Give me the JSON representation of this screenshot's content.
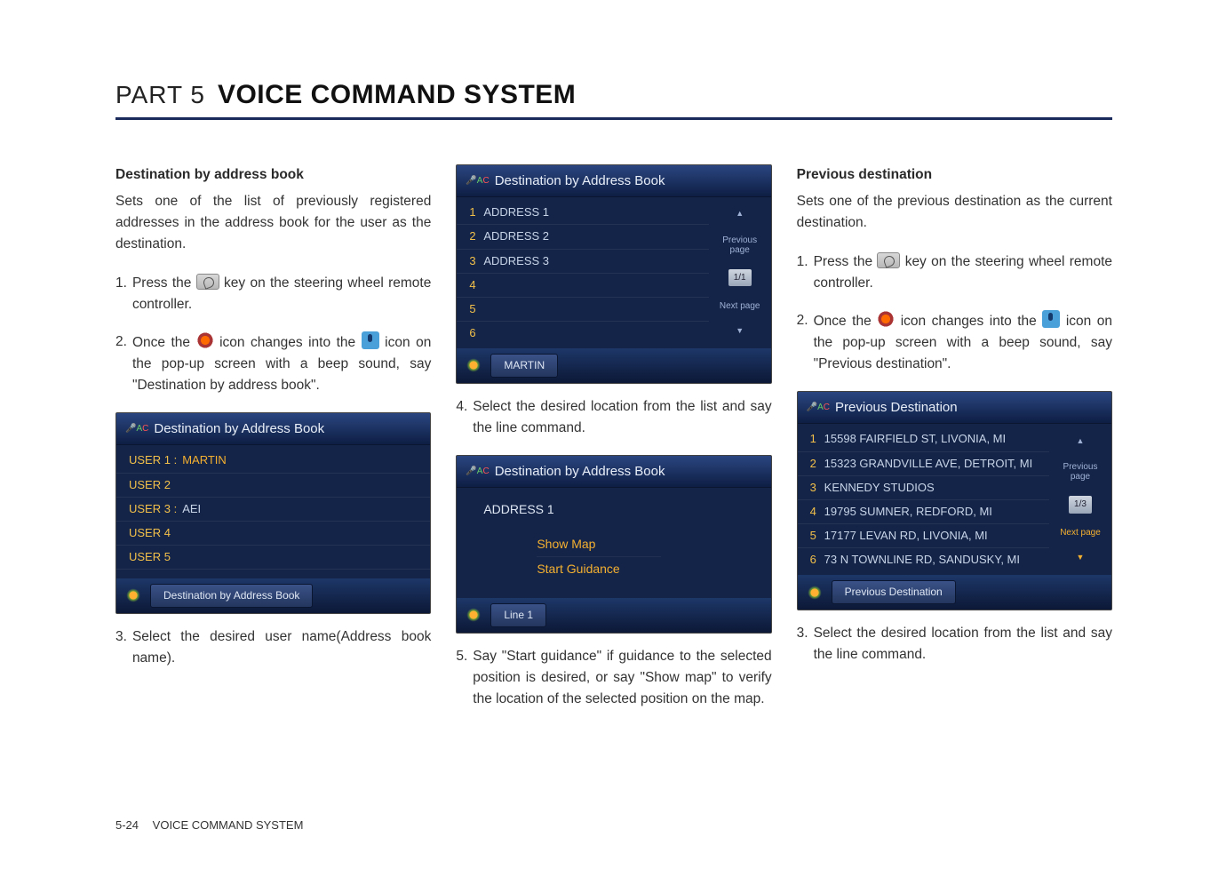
{
  "header": {
    "part_label": "PART 5",
    "title": "VOICE COMMAND SYSTEM"
  },
  "col1": {
    "subhead": "Destination by address book",
    "intro": "Sets one of the list of previously registered addresses in the address book for the user as the destination.",
    "step1_num": "1.",
    "step1a": "Press the ",
    "step1b": " key on the steering wheel remote controller.",
    "step2_num": "2.",
    "step2a": "Once the ",
    "step2b": " icon changes into the ",
    "step2c": " icon on the pop-up screen with a beep sound, say \"Destination by address book\".",
    "shot_title": "Destination by Address Book",
    "users": [
      {
        "label": "USER 1 :",
        "name": "MARTIN",
        "highlight": true
      },
      {
        "label": "USER 2",
        "name": "",
        "highlight": false
      },
      {
        "label": "USER 3 :",
        "name": "AEI",
        "highlight": false
      },
      {
        "label": "USER 4",
        "name": "",
        "highlight": false
      },
      {
        "label": "USER 5",
        "name": "",
        "highlight": false
      }
    ],
    "foot": "Destination by Address Book",
    "step3_num": "3.",
    "step3": "Select the desired user name(Address book name)."
  },
  "col2": {
    "shot1_title": "Destination by Address Book",
    "addr_rows": [
      {
        "idx": "1",
        "val": "ADDRESS 1"
      },
      {
        "idx": "2",
        "val": "ADDRESS 2"
      },
      {
        "idx": "3",
        "val": "ADDRESS 3"
      },
      {
        "idx": "4",
        "val": ""
      },
      {
        "idx": "5",
        "val": ""
      },
      {
        "idx": "6",
        "val": ""
      }
    ],
    "side_prev": "Previous page",
    "side_pager": "1/1",
    "side_next": "Next page",
    "foot1": "MARTIN",
    "step4_num": "4.",
    "step4": "Select the desired location from the list and say the line command.",
    "shot2_title": "Destination by Address Book",
    "addr_header": "ADDRESS 1",
    "opt1": "Show Map",
    "opt2": "Start Guidance",
    "foot2": "Line 1",
    "step5_num": "5.",
    "step5": "Say \"Start guidance\" if guidance to the selected position is desired, or say \"Show map\" to verify the location of the selected position on the map."
  },
  "col3": {
    "subhead": "Previous destination",
    "intro": "Sets one of the previous destination as the current destination.",
    "step1_num": "1.",
    "step1a": "Press the ",
    "step1b": " key on the steering wheel remote controller.",
    "step2_num": "2.",
    "step2a": "Once the ",
    "step2b": " icon changes into the ",
    "step2c": " icon on the pop-up screen with a beep sound, say \"Previous destination\".",
    "shot_title": "Previous Destination",
    "rows": [
      {
        "idx": "1",
        "val": "15598 FAIRFIELD ST, LIVONIA, MI"
      },
      {
        "idx": "2",
        "val": "15323 GRANDVILLE AVE, DETROIT, MI"
      },
      {
        "idx": "3",
        "val": "KENNEDY STUDIOS"
      },
      {
        "idx": "4",
        "val": "19795 SUMNER, REDFORD, MI"
      },
      {
        "idx": "5",
        "val": "17177 LEVAN RD, LIVONIA, MI"
      },
      {
        "idx": "6",
        "val": "73 N TOWNLINE RD, SANDUSKY, MI"
      }
    ],
    "side_prev": "Previous page",
    "side_pager": "1/3",
    "side_next": "Next page",
    "foot": "Previous Destination",
    "step3_num": "3.",
    "step3": "Select the desired location from the list and say the line command."
  },
  "footer": {
    "page": "5-24",
    "label": "VOICE COMMAND SYSTEM"
  }
}
